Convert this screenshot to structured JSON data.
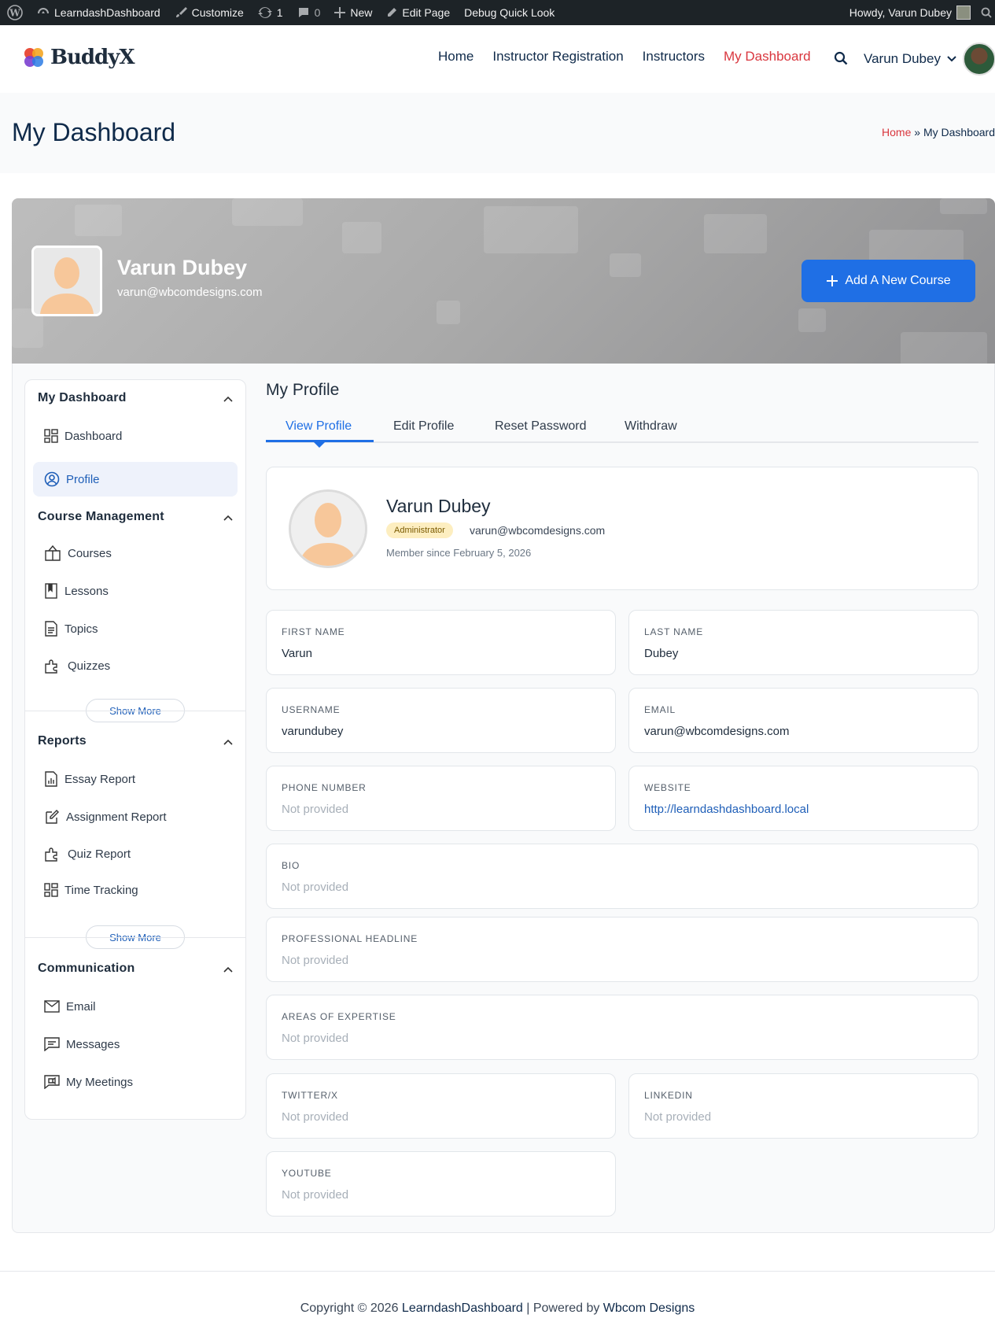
{
  "admin_bar": {
    "site": "LearndashDashboard",
    "customize": "Customize",
    "updates": "1",
    "comments": "0",
    "new": "New",
    "edit_page": "Edit Page",
    "debug": "Debug Quick Look",
    "howdy": "Howdy, Varun Dubey"
  },
  "header": {
    "logo": "BuddyX",
    "nav": [
      "Home",
      "Instructor Registration",
      "Instructors",
      "My Dashboard"
    ],
    "user": "Varun Dubey"
  },
  "page": {
    "title": "My Dashboard",
    "breadcrumb_home": "Home",
    "breadcrumb_sep": "»",
    "breadcrumb_current": "My Dashboard"
  },
  "cover": {
    "name": "Varun Dubey",
    "email": "varun@wbcomdesigns.com",
    "add_course": "Add A New Course"
  },
  "sidebar": {
    "sections": [
      {
        "title": "My Dashboard",
        "items": [
          "Dashboard",
          "Profile"
        ]
      },
      {
        "title": "Course Management",
        "items": [
          "Courses",
          "Lessons",
          "Topics",
          "Quizzes"
        ],
        "more": "Show More"
      },
      {
        "title": "Reports",
        "items": [
          "Essay Report",
          "Assignment Report",
          "Quiz Report",
          "Time Tracking"
        ],
        "more": "Show More"
      },
      {
        "title": "Communication",
        "items": [
          "Email",
          "Messages",
          "My Meetings"
        ]
      }
    ]
  },
  "content": {
    "title": "My Profile",
    "tabs": [
      "View Profile",
      "Edit Profile",
      "Reset Password",
      "Withdraw"
    ],
    "summary": {
      "name": "Varun Dubey",
      "role": "Administrator",
      "email": "varun@wbcomdesigns.com",
      "since": "Member since February 5, 2026"
    },
    "fields": [
      {
        "label": "First Name",
        "value": "Varun"
      },
      {
        "label": "Last Name",
        "value": "Dubey"
      },
      {
        "label": "Username",
        "value": "varundubey"
      },
      {
        "label": "Email",
        "value": "varun@wbcomdesigns.com"
      },
      {
        "label": "Phone Number",
        "value": "Not provided"
      },
      {
        "label": "Website",
        "value": "http://learndashdashboard.local"
      },
      {
        "label": "Bio",
        "value": "Not provided"
      },
      {
        "label": "Professional Headline",
        "value": "Not provided"
      },
      {
        "label": "Areas of Expertise",
        "value": "Not provided"
      },
      {
        "label": "Twitter/X",
        "value": "Not provided"
      },
      {
        "label": "LinkedIn",
        "value": "Not provided"
      },
      {
        "label": "YouTube",
        "value": "Not provided"
      }
    ]
  },
  "footer": {
    "prefix": "Copyright © 2026 ",
    "site": "LearndashDashboard",
    "mid": " | Powered by ",
    "powered": "Wbcom Designs"
  },
  "colors": {
    "accent": "#1f6fe5",
    "active_nav": "#d9363e",
    "admin_bar": "#1d2327"
  }
}
